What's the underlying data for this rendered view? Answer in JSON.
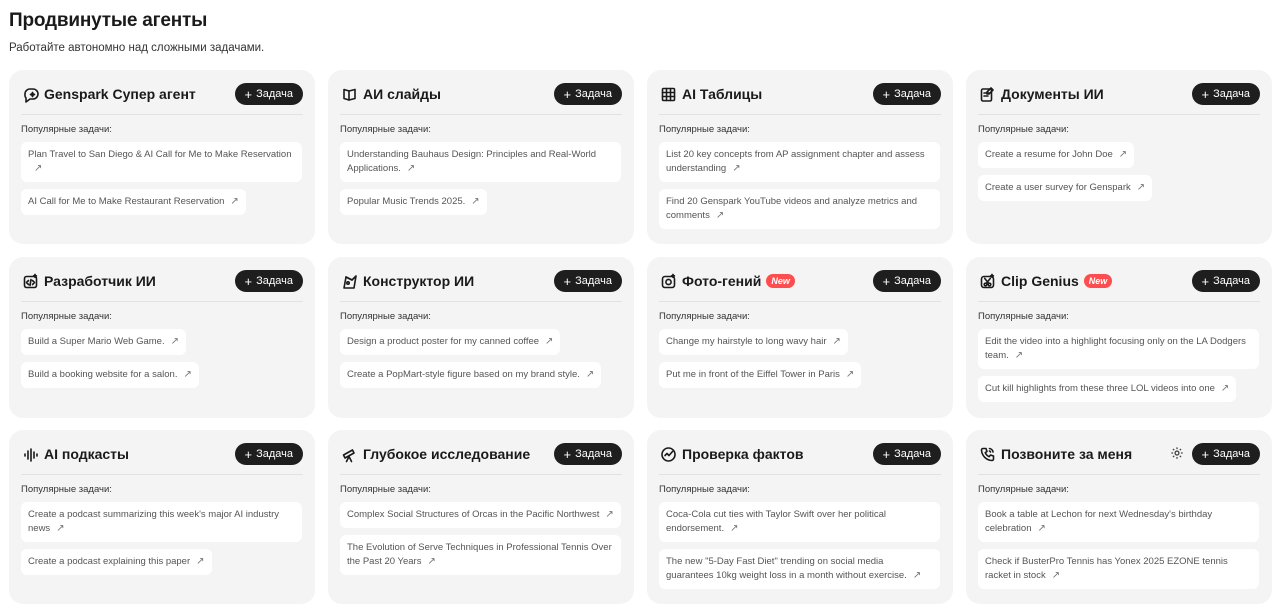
{
  "page": {
    "title": "Продвинутые агенты",
    "subtitle": "Работайте автономно над сложными задачами."
  },
  "common": {
    "task_button_label": "Задача",
    "popular_label": "Популярные задачи:",
    "new_badge": "New"
  },
  "agents": [
    {
      "title": "Genspark Супер агент",
      "icon": "chat-sparkle-icon",
      "tasks": [
        "Plan Travel to San Diego & AI Call for Me to Make Reservation",
        "AI Call for Me to Make Restaurant Reservation"
      ]
    },
    {
      "title": "АИ слайды",
      "icon": "slides-icon",
      "tasks": [
        "Understanding Bauhaus Design: Principles and Real-World Applications.",
        "Popular Music Trends 2025."
      ]
    },
    {
      "title": "AI Таблицы",
      "icon": "table-grid-icon",
      "tasks": [
        "List 20 key concepts from AP assignment chapter and assess understanding",
        "Find 20 Genspark YouTube videos and analyze metrics and comments"
      ]
    },
    {
      "title": "Документы ИИ",
      "icon": "document-edit-icon",
      "tasks": [
        "Create a resume for John Doe",
        "Create a user survey for Genspark"
      ]
    },
    {
      "title": "Разработчик ИИ",
      "icon": "code-icon",
      "tasks": [
        "Build a Super Mario Web Game.",
        "Build a booking website for a salon."
      ]
    },
    {
      "title": "Конструктор ИИ",
      "icon": "designer-icon",
      "tasks": [
        "Design a product poster for my canned coffee",
        "Create a PopMart-style figure based on my brand style."
      ]
    },
    {
      "title": "Фото-гений",
      "icon": "photo-sparkle-icon",
      "new": true,
      "tasks": [
        "Change my hairstyle to long wavy hair",
        "Put me in front of the Eiffel Tower in Paris"
      ]
    },
    {
      "title": "Clip Genius",
      "icon": "clip-scissors-icon",
      "new": true,
      "tasks": [
        "Edit the video into a highlight focusing only on the LA Dodgers team.",
        "Cut kill highlights from these three LOL videos into one"
      ]
    },
    {
      "title": "AI подкасты",
      "icon": "audio-wave-icon",
      "tasks": [
        "Create a podcast summarizing this week's major AI industry news",
        "Create a podcast explaining this paper"
      ]
    },
    {
      "title": "Глубокое исследование",
      "icon": "telescope-icon",
      "tasks": [
        "Complex Social Structures of Orcas in the Pacific Northwest",
        "The Evolution of Serve Techniques in Professional Tennis Over the Past 20 Years"
      ]
    },
    {
      "title": "Проверка фактов",
      "icon": "check-circle-icon",
      "tasks": [
        "Coca-Cola cut ties with Taylor Swift over her political endorsement.",
        "The new \"5-Day Fast Diet\" trending on social media guarantees 10kg weight loss in a month without exercise."
      ]
    },
    {
      "title": "Позвоните за меня",
      "icon": "phone-icon",
      "settings": true,
      "tasks": [
        "Book a table at Lechon for next Wednesday's birthday celebration",
        "Check if BusterPro Tennis has Yonex 2025 EZONE tennis racket in stock"
      ]
    }
  ]
}
